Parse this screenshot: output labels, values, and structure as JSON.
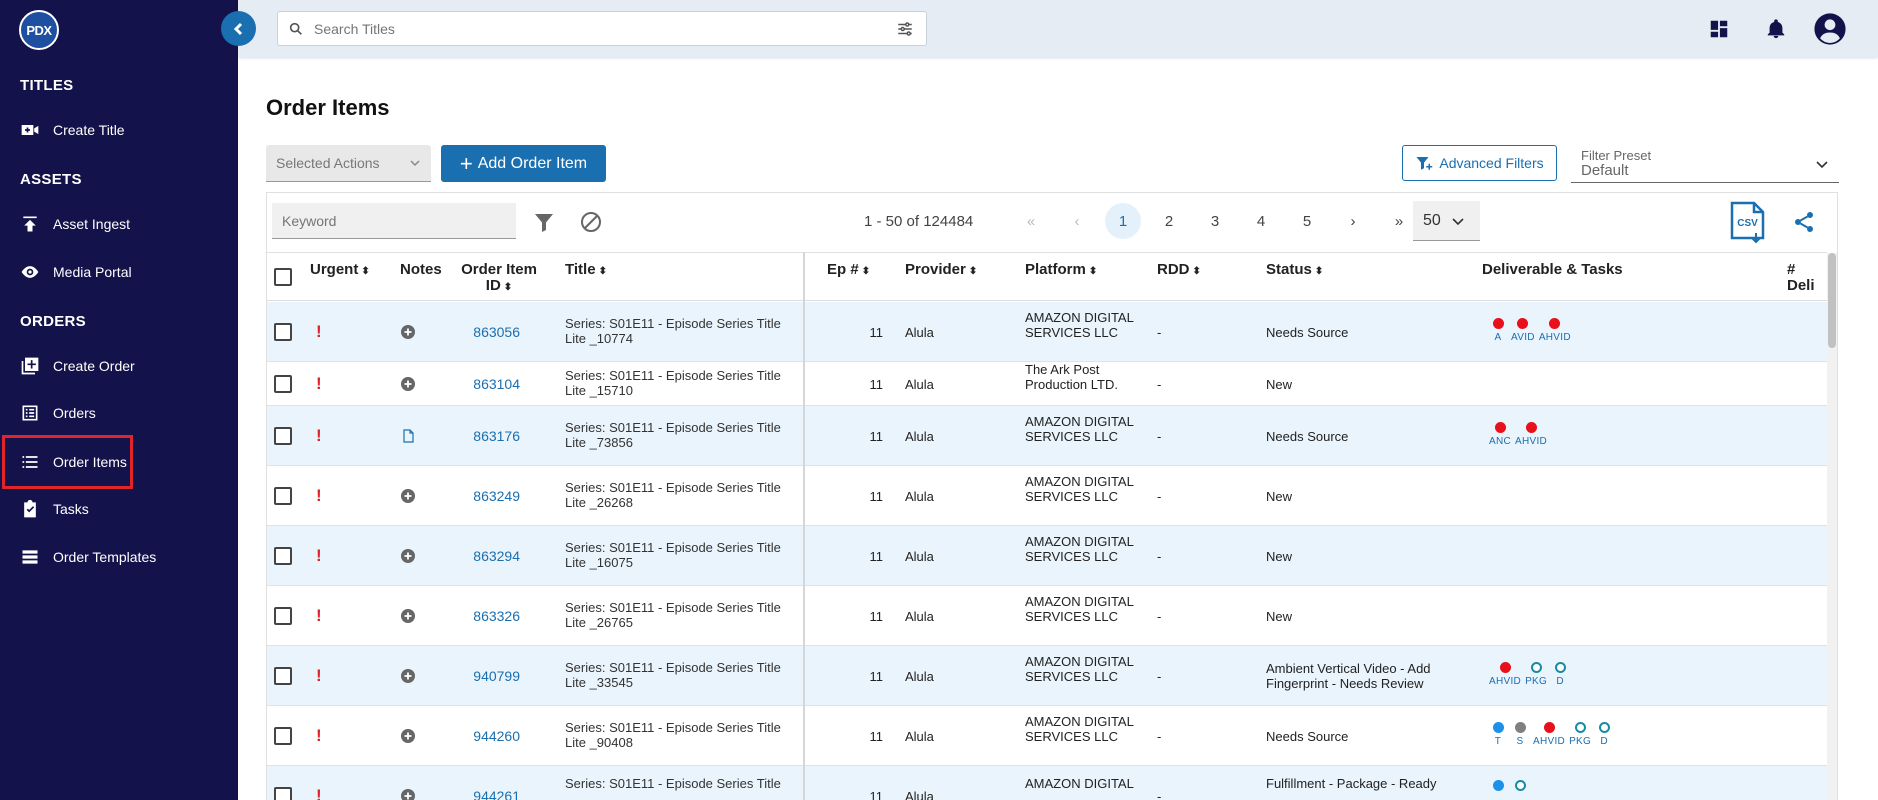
{
  "sidebar": {
    "logo": "PDX",
    "sections": {
      "titles": "TITLES",
      "assets": "ASSETS",
      "orders": "ORDERS"
    },
    "items": {
      "create_title": "Create Title",
      "asset_ingest": "Asset Ingest",
      "media_portal": "Media Portal",
      "create_order": "Create Order",
      "orders": "Orders",
      "order_items": "Order Items",
      "tasks": "Tasks",
      "order_templates": "Order Templates"
    },
    "selected": "order_items"
  },
  "topbar": {
    "search_placeholder": "Search Titles"
  },
  "main": {
    "title": "Order Items",
    "selected_actions": "Selected Actions",
    "add_button": "Add Order Item",
    "advanced_filters": "Advanced Filters",
    "filter_preset_label": "Filter Preset",
    "filter_preset_value": "Default"
  },
  "toolbar": {
    "keyword_placeholder": "Keyword",
    "range": "1 - 50 of 124484",
    "pages": [
      "1",
      "2",
      "3",
      "4",
      "5"
    ],
    "active_page": "1",
    "first": "«",
    "prev": "‹",
    "next": "›",
    "last": "»",
    "per_page": "50",
    "csv_label": "CSV"
  },
  "table": {
    "headers": {
      "urgent": "Urgent",
      "notes": "Notes",
      "order_item_id_1": "Order Item",
      "order_item_id_2": "ID",
      "title": "Title",
      "ep": "Ep #",
      "provider": "Provider",
      "platform": "Platform",
      "rdd": "RDD",
      "status": "Status",
      "deliverables": "Deliverable & Tasks",
      "num_deli": "# Deli"
    },
    "rows": [
      {
        "urgent": "!",
        "note": "add",
        "id": "863056",
        "title": "Series: S01E11 - Episode Series Title Lite _10774",
        "ep": "11",
        "provider": "Alula",
        "platform": "AMAZON DIGITAL SERVICES LLC",
        "rdd": "-",
        "status": "Needs Source",
        "tags": [
          {
            "label": "A",
            "state": "red"
          },
          {
            "label": "AVID",
            "state": "red"
          },
          {
            "label": "AHVID",
            "state": "red"
          }
        ]
      },
      {
        "urgent": "!",
        "note": "add",
        "id": "863104",
        "title": "Series: S01E11 - Episode Series Title Lite _15710",
        "ep": "11",
        "provider": "Alula",
        "platform": "The Ark Post Production LTD.",
        "rdd": "-",
        "status": "New",
        "tags": []
      },
      {
        "urgent": "!",
        "note": "doc",
        "id": "863176",
        "title": "Series: S01E11 - Episode Series Title Lite _73856",
        "ep": "11",
        "provider": "Alula",
        "platform": "AMAZON DIGITAL SERVICES LLC",
        "rdd": "-",
        "status": "Needs Source",
        "tags": [
          {
            "label": "ANC",
            "state": "red"
          },
          {
            "label": "AHVID",
            "state": "red"
          }
        ]
      },
      {
        "urgent": "!",
        "note": "add",
        "id": "863249",
        "title": "Series: S01E11 - Episode Series Title Lite _26268",
        "ep": "11",
        "provider": "Alula",
        "platform": "AMAZON DIGITAL SERVICES LLC",
        "rdd": "-",
        "status": "New",
        "tags": []
      },
      {
        "urgent": "!",
        "note": "add",
        "id": "863294",
        "title": "Series: S01E11 - Episode Series Title Lite _16075",
        "ep": "11",
        "provider": "Alula",
        "platform": "AMAZON DIGITAL SERVICES LLC",
        "rdd": "-",
        "status": "New",
        "tags": []
      },
      {
        "urgent": "!",
        "note": "add",
        "id": "863326",
        "title": "Series: S01E11 - Episode Series Title Lite _26765",
        "ep": "11",
        "provider": "Alula",
        "platform": "AMAZON DIGITAL SERVICES LLC",
        "rdd": "-",
        "status": "New",
        "tags": []
      },
      {
        "urgent": "!",
        "note": "add",
        "id": "940799",
        "title": "Series: S01E11 - Episode Series Title Lite _33545",
        "ep": "11",
        "provider": "Alula",
        "platform": "AMAZON DIGITAL SERVICES LLC",
        "rdd": "-",
        "status": "Ambient Vertical Video - Add Fingerprint - Needs Review",
        "tags": [
          {
            "label": "AHVID",
            "state": "red"
          },
          {
            "label": "PKG",
            "state": "outline"
          },
          {
            "label": "D",
            "state": "outline"
          }
        ]
      },
      {
        "urgent": "!",
        "note": "add",
        "id": "944260",
        "title": "Series: S01E11 - Episode Series Title Lite _90408",
        "ep": "11",
        "provider": "Alula",
        "platform": "AMAZON DIGITAL SERVICES LLC",
        "rdd": "-",
        "status": "Needs Source",
        "tags": [
          {
            "label": "T",
            "state": "blue"
          },
          {
            "label": "S",
            "state": "gray"
          },
          {
            "label": "AHVID",
            "state": "red"
          },
          {
            "label": "PKG",
            "state": "outline"
          },
          {
            "label": "D",
            "state": "outline"
          }
        ]
      },
      {
        "urgent": "!",
        "note": "add",
        "id": "944261",
        "title": "Series: S01E11 - Episode Series Title",
        "ep": "11",
        "provider": "Alula",
        "platform": "AMAZON DIGITAL",
        "rdd": "-",
        "status": "Fulfillment - Package - Ready",
        "tags": [
          {
            "label": "",
            "state": "blue"
          },
          {
            "label": "",
            "state": "outline"
          }
        ]
      }
    ]
  },
  "colors": {
    "sidebar_bg": "#13124a",
    "accent": "#1a6fb0",
    "urgent": "#e0242c",
    "row_alt": "#eaf4fc"
  }
}
